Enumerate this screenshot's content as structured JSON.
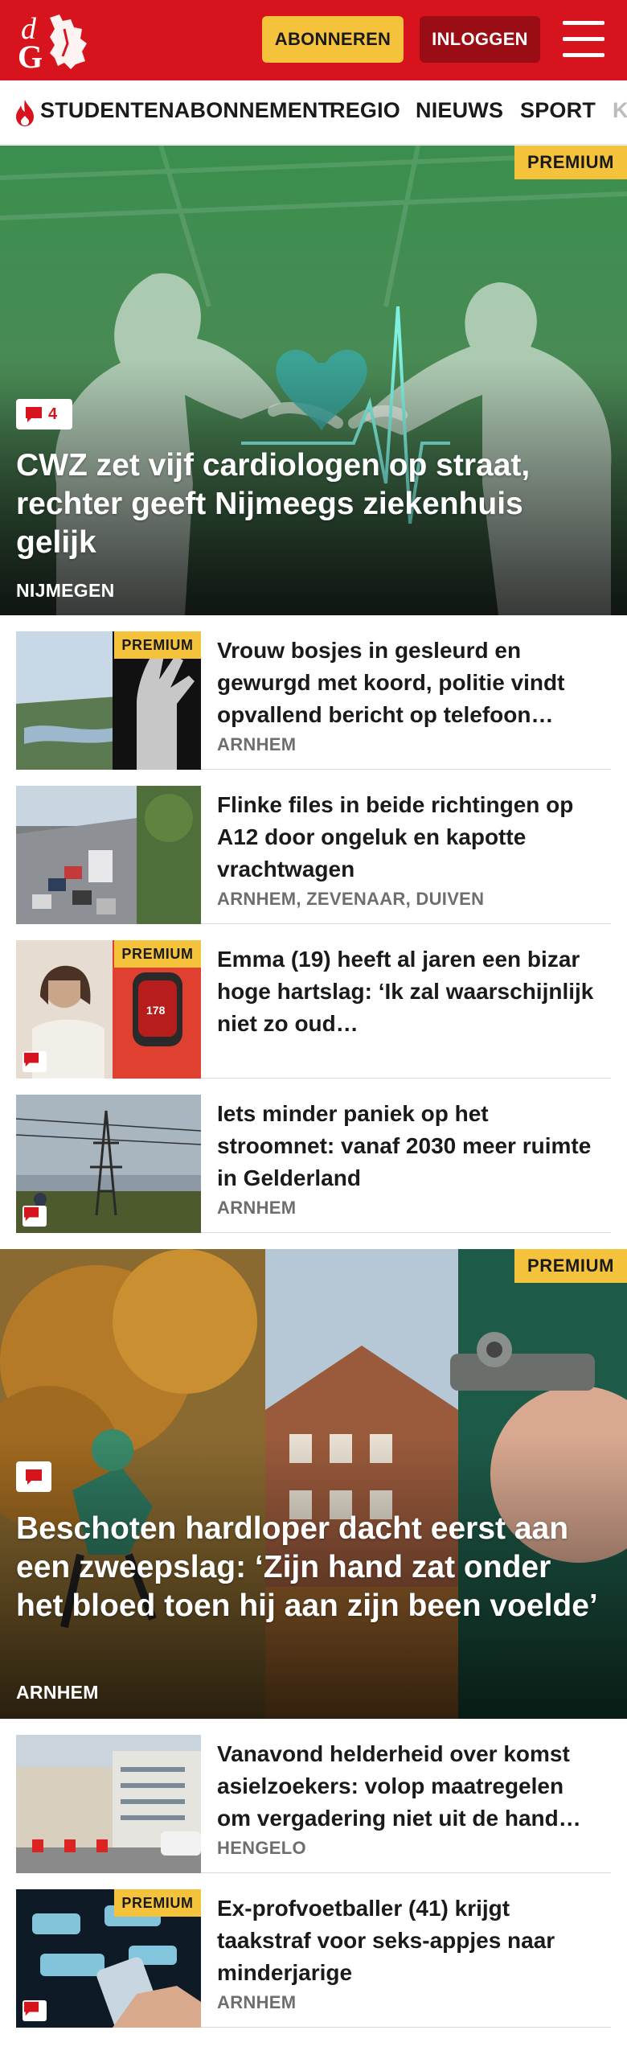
{
  "header": {
    "logo_letters": "dG",
    "subscribe_label": "ABONNEREN",
    "login_label": "INLOGGEN",
    "menu_icon": "hamburger-menu-icon",
    "brand_color": "#d7141e"
  },
  "nav": {
    "items": [
      {
        "label": "STUDENTENABONNEMENT",
        "icon": "flame-icon"
      },
      {
        "label": "REGIO"
      },
      {
        "label": "NIEUWS"
      },
      {
        "label": "SPORT"
      },
      {
        "label": "K"
      }
    ]
  },
  "articles": {
    "hero1": {
      "premium_label": "PREMIUM",
      "comment_count": "4",
      "title": "CWZ zet vijf cardiologen op straat, rechter geeft Nijmeegs ziekenhuis gelijk",
      "location": "NIJMEGEN"
    },
    "list1": [
      {
        "premium_label": "PREMIUM",
        "title": "Vrouw bosjes in gesleurd en gewurgd met koord, politie vindt opvallend bericht op telefoon…",
        "location": "ARNHEM"
      },
      {
        "title": "Flinke files in beide richtingen op A12 door ongeluk en kapotte vrachtwagen",
        "location": "ARNHEM, ZEVENAAR, DUIVEN"
      },
      {
        "premium_label": "PREMIUM",
        "title": "Emma (19) heeft al jaren een bizar hoge hartslag: ‘Ik zal waarschijnlijk niet zo oud…",
        "location": ""
      },
      {
        "title": "Iets minder paniek op het stroomnet: vanaf 2030 meer ruimte in Gelderland",
        "location": "ARNHEM"
      }
    ],
    "hero2": {
      "premium_label": "PREMIUM",
      "title": "Beschoten hardloper dacht eerst aan een zweepslag: ‘Zijn hand zat onder het bloed toen hij aan zijn been voelde’",
      "location": "ARNHEM"
    },
    "list2": [
      {
        "title": "Vanavond helderheid over komst asielzoekers: volop maatregelen om vergadering niet uit de hand…",
        "location": "HENGELO"
      },
      {
        "premium_label": "PREMIUM",
        "title": "Ex-profvoetballer (41) krijgt taakstraf voor seks-appjes naar minderjarige",
        "location": "ARNHEM"
      }
    ]
  },
  "colors": {
    "accent": "#d7141e",
    "premium": "#f5c33b",
    "login_button": "#9b0d14"
  }
}
